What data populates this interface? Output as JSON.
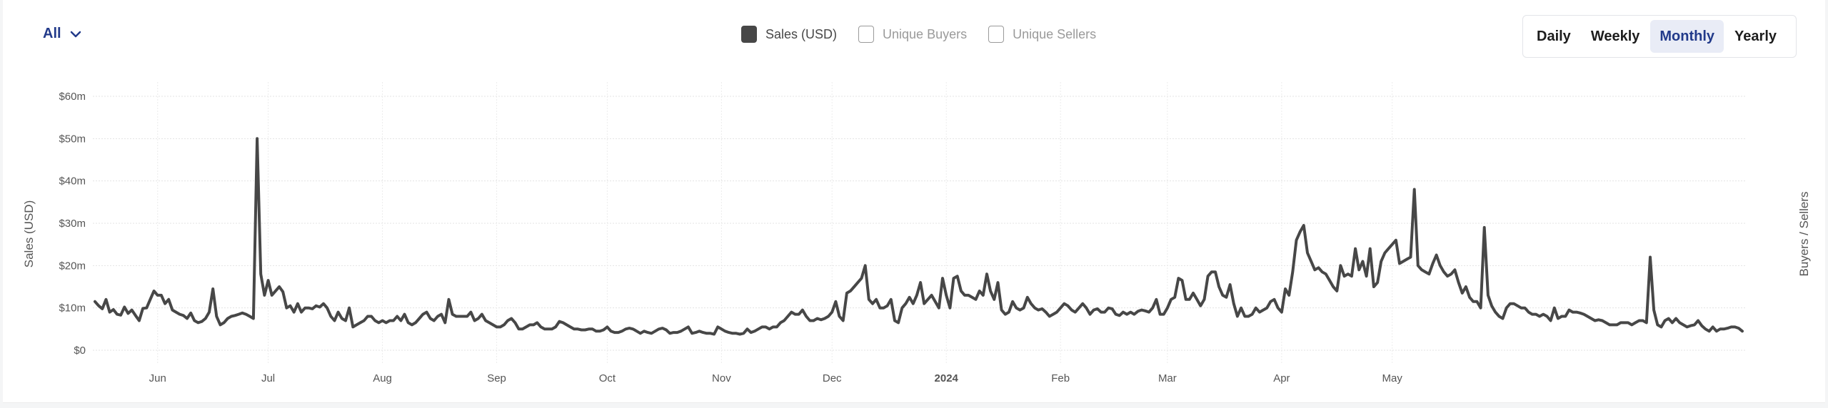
{
  "filter": {
    "label": "All",
    "icon": "chevron-down-icon"
  },
  "legend": [
    {
      "label": "Sales (USD)",
      "checked": true,
      "color": "#474747"
    },
    {
      "label": "Unique Buyers",
      "checked": false,
      "color": "#9a9a9a"
    },
    {
      "label": "Unique Sellers",
      "checked": false,
      "color": "#9a9a9a"
    }
  ],
  "period": {
    "options": [
      "Daily",
      "Weekly",
      "Monthly",
      "Yearly"
    ],
    "active": "Monthly",
    "active_color": "#223a8a"
  },
  "chart_data": {
    "type": "line",
    "title": "",
    "xlabel": "",
    "ylabel": "Sales (USD)",
    "y2label": "Buyers / Sellers",
    "ylim": [
      0,
      60
    ],
    "yunit": "USD millions",
    "yticks": [
      "$0",
      "$10m",
      "$20m",
      "$30m",
      "$40m",
      "$50m",
      "$60m"
    ],
    "xticks": [
      {
        "label": "Jun",
        "bold": false
      },
      {
        "label": "Jul",
        "bold": false
      },
      {
        "label": "Aug",
        "bold": false
      },
      {
        "label": "Sep",
        "bold": false
      },
      {
        "label": "Oct",
        "bold": false
      },
      {
        "label": "Nov",
        "bold": false
      },
      {
        "label": "Dec",
        "bold": false
      },
      {
        "label": "2024",
        "bold": true
      },
      {
        "label": "Feb",
        "bold": false
      },
      {
        "label": "Mar",
        "bold": false
      },
      {
        "label": "Apr",
        "bold": false
      },
      {
        "label": "May",
        "bold": false
      }
    ],
    "grid": true,
    "series": [
      {
        "name": "Sales (USD)",
        "color": "#474747",
        "x_start": "2023-05-15",
        "x_step": "1 day",
        "values": [
          11.5,
          10.5,
          9.8,
          12,
          9,
          9.6,
          8.5,
          8.3,
          10.2,
          8.7,
          9.5,
          8.2,
          7,
          9.9,
          10,
          12,
          14,
          13,
          13,
          11,
          12,
          9.5,
          9,
          8.5,
          8.2,
          7.5,
          8.8,
          7,
          6.5,
          6.8,
          7.5,
          9,
          14.5,
          8,
          6,
          6.5,
          7.5,
          8,
          8.2,
          8.5,
          8.8,
          8.5,
          8,
          7.5,
          50,
          18,
          13,
          16.5,
          13,
          14,
          15,
          13.8,
          10,
          10.5,
          9,
          11,
          9,
          10,
          10,
          9.8,
          10.5,
          10.2,
          11,
          10,
          8,
          7,
          9,
          7.5,
          7,
          10,
          5.5,
          6,
          6.5,
          7,
          8,
          8,
          7,
          6.5,
          7,
          6.5,
          7,
          7,
          8,
          7,
          8.5,
          6.5,
          6,
          6.5,
          7.5,
          8.5,
          9,
          7.5,
          7,
          8,
          8.5,
          6.5,
          12,
          8.5,
          8,
          8,
          8,
          8,
          9,
          7,
          7.5,
          8.5,
          7,
          6.5,
          6,
          5.5,
          5.5,
          6,
          7,
          7.5,
          6.5,
          5,
          5,
          5.5,
          6,
          6,
          6.5,
          5.5,
          5,
          5,
          5,
          5.5,
          6.8,
          6.5,
          6,
          5.5,
          5,
          5,
          4.8,
          4.8,
          5,
          5,
          4.5,
          4.5,
          4.8,
          5.5,
          4.5,
          4.2,
          4.2,
          4.5,
          5,
          5.2,
          5,
          4.5,
          4,
          4.5,
          4.2,
          4,
          4.5,
          5,
          5.2,
          4.8,
          4,
          4.2,
          4.2,
          4.5,
          5,
          5.5,
          4,
          4.2,
          4.5,
          4.2,
          4,
          4,
          3.8,
          5.5,
          5,
          4.5,
          4.2,
          4,
          4,
          3.8,
          4,
          5,
          4.2,
          4.5,
          5,
          5.5,
          5.5,
          5,
          5.5,
          5.5,
          6.5,
          7,
          8,
          9,
          8.5,
          8.5,
          9.5,
          8,
          7,
          7,
          7.5,
          7.2,
          7.5,
          8,
          9,
          11.5,
          8,
          7,
          13.5,
          14,
          15,
          16,
          17,
          20,
          12,
          11,
          12,
          10,
          10,
          10.5,
          12,
          7,
          6.5,
          10,
          11,
          12.5,
          11,
          13,
          16,
          11,
          12,
          13,
          11.5,
          10,
          17,
          13,
          10,
          17,
          17.5,
          14,
          13,
          13,
          12.5,
          12,
          14,
          13,
          18,
          14,
          12,
          16,
          9.5,
          8.5,
          9,
          11.5,
          10,
          9.5,
          10,
          12.5,
          11,
          10,
          9.5,
          9.8,
          9,
          8,
          8.5,
          9,
          10,
          11,
          10.5,
          9.5,
          9,
          10,
          11,
          10,
          8.5,
          9.5,
          9.8,
          9,
          9,
          10,
          9.8,
          8.5,
          8.2,
          9,
          8.5,
          9,
          8.5,
          9.2,
          9.5,
          9.3,
          9,
          10,
          12,
          8.5,
          8.5,
          10,
          12,
          12.5,
          17,
          16.5,
          12,
          12,
          13.5,
          12,
          10.5,
          12,
          17.5,
          18.5,
          18.5,
          15,
          13,
          12.5,
          15.5,
          11,
          8,
          10,
          8,
          8,
          8.5,
          10,
          9,
          9.5,
          10,
          11.5,
          12,
          10,
          9,
          14.5,
          13,
          18.5,
          26,
          28,
          29.5,
          23,
          21,
          19,
          19.5,
          18.5,
          18,
          16.5,
          15,
          14,
          20,
          17.5,
          18,
          17.5,
          24,
          19,
          21,
          17.5,
          24,
          15,
          16,
          21,
          23,
          24,
          25,
          26,
          20.5,
          21,
          21.5,
          22,
          38,
          20,
          19,
          18.5,
          18,
          20.5,
          22.5,
          20,
          18.5,
          17.5,
          18,
          19,
          16,
          13.5,
          15,
          12.5,
          11.5,
          11.5,
          10,
          29,
          13,
          10.5,
          9,
          8,
          7.5,
          10,
          11,
          11,
          10.5,
          10,
          10,
          9,
          8.5,
          8.5,
          8,
          8.5,
          8,
          7,
          10,
          7.5,
          8,
          8,
          9.5,
          9,
          9,
          8.8,
          8.5,
          8,
          7.5,
          7,
          7.2,
          7,
          6.5,
          6,
          6,
          6,
          6.5,
          6.5,
          6.5,
          6,
          6.5,
          7,
          7,
          6.5,
          22,
          9.5,
          6,
          5.5,
          7,
          7.5,
          6.5,
          7.5,
          6.5,
          6,
          5.5,
          5.8,
          6,
          7,
          5.8,
          5,
          4.5,
          5.5,
          4.5,
          5,
          5,
          5.2,
          5.5,
          5.5,
          5.2,
          4.5
        ]
      }
    ]
  }
}
